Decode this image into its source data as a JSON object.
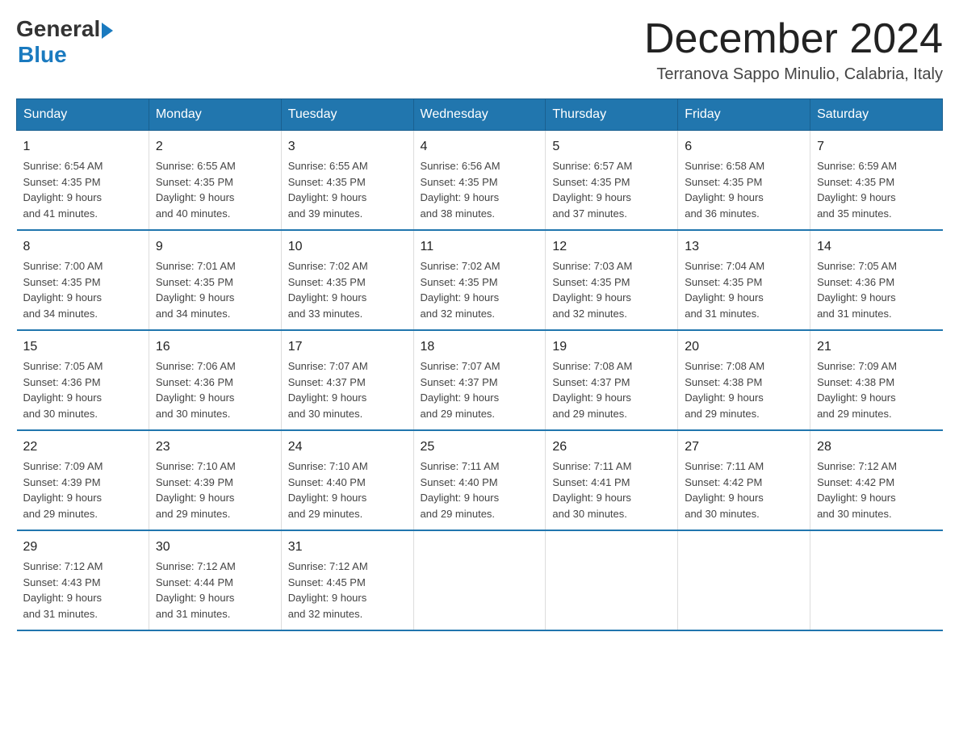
{
  "logo": {
    "general": "General",
    "blue": "Blue"
  },
  "title": {
    "month_year": "December 2024",
    "location": "Terranova Sappo Minulio, Calabria, Italy"
  },
  "header_days": [
    "Sunday",
    "Monday",
    "Tuesday",
    "Wednesday",
    "Thursday",
    "Friday",
    "Saturday"
  ],
  "weeks": [
    [
      {
        "day": "1",
        "sunrise": "6:54 AM",
        "sunset": "4:35 PM",
        "daylight": "9 hours and 41 minutes."
      },
      {
        "day": "2",
        "sunrise": "6:55 AM",
        "sunset": "4:35 PM",
        "daylight": "9 hours and 40 minutes."
      },
      {
        "day": "3",
        "sunrise": "6:55 AM",
        "sunset": "4:35 PM",
        "daylight": "9 hours and 39 minutes."
      },
      {
        "day": "4",
        "sunrise": "6:56 AM",
        "sunset": "4:35 PM",
        "daylight": "9 hours and 38 minutes."
      },
      {
        "day": "5",
        "sunrise": "6:57 AM",
        "sunset": "4:35 PM",
        "daylight": "9 hours and 37 minutes."
      },
      {
        "day": "6",
        "sunrise": "6:58 AM",
        "sunset": "4:35 PM",
        "daylight": "9 hours and 36 minutes."
      },
      {
        "day": "7",
        "sunrise": "6:59 AM",
        "sunset": "4:35 PM",
        "daylight": "9 hours and 35 minutes."
      }
    ],
    [
      {
        "day": "8",
        "sunrise": "7:00 AM",
        "sunset": "4:35 PM",
        "daylight": "9 hours and 34 minutes."
      },
      {
        "day": "9",
        "sunrise": "7:01 AM",
        "sunset": "4:35 PM",
        "daylight": "9 hours and 34 minutes."
      },
      {
        "day": "10",
        "sunrise": "7:02 AM",
        "sunset": "4:35 PM",
        "daylight": "9 hours and 33 minutes."
      },
      {
        "day": "11",
        "sunrise": "7:02 AM",
        "sunset": "4:35 PM",
        "daylight": "9 hours and 32 minutes."
      },
      {
        "day": "12",
        "sunrise": "7:03 AM",
        "sunset": "4:35 PM",
        "daylight": "9 hours and 32 minutes."
      },
      {
        "day": "13",
        "sunrise": "7:04 AM",
        "sunset": "4:35 PM",
        "daylight": "9 hours and 31 minutes."
      },
      {
        "day": "14",
        "sunrise": "7:05 AM",
        "sunset": "4:36 PM",
        "daylight": "9 hours and 31 minutes."
      }
    ],
    [
      {
        "day": "15",
        "sunrise": "7:05 AM",
        "sunset": "4:36 PM",
        "daylight": "9 hours and 30 minutes."
      },
      {
        "day": "16",
        "sunrise": "7:06 AM",
        "sunset": "4:36 PM",
        "daylight": "9 hours and 30 minutes."
      },
      {
        "day": "17",
        "sunrise": "7:07 AM",
        "sunset": "4:37 PM",
        "daylight": "9 hours and 30 minutes."
      },
      {
        "day": "18",
        "sunrise": "7:07 AM",
        "sunset": "4:37 PM",
        "daylight": "9 hours and 29 minutes."
      },
      {
        "day": "19",
        "sunrise": "7:08 AM",
        "sunset": "4:37 PM",
        "daylight": "9 hours and 29 minutes."
      },
      {
        "day": "20",
        "sunrise": "7:08 AM",
        "sunset": "4:38 PM",
        "daylight": "9 hours and 29 minutes."
      },
      {
        "day": "21",
        "sunrise": "7:09 AM",
        "sunset": "4:38 PM",
        "daylight": "9 hours and 29 minutes."
      }
    ],
    [
      {
        "day": "22",
        "sunrise": "7:09 AM",
        "sunset": "4:39 PM",
        "daylight": "9 hours and 29 minutes."
      },
      {
        "day": "23",
        "sunrise": "7:10 AM",
        "sunset": "4:39 PM",
        "daylight": "9 hours and 29 minutes."
      },
      {
        "day": "24",
        "sunrise": "7:10 AM",
        "sunset": "4:40 PM",
        "daylight": "9 hours and 29 minutes."
      },
      {
        "day": "25",
        "sunrise": "7:11 AM",
        "sunset": "4:40 PM",
        "daylight": "9 hours and 29 minutes."
      },
      {
        "day": "26",
        "sunrise": "7:11 AM",
        "sunset": "4:41 PM",
        "daylight": "9 hours and 30 minutes."
      },
      {
        "day": "27",
        "sunrise": "7:11 AM",
        "sunset": "4:42 PM",
        "daylight": "9 hours and 30 minutes."
      },
      {
        "day": "28",
        "sunrise": "7:12 AM",
        "sunset": "4:42 PM",
        "daylight": "9 hours and 30 minutes."
      }
    ],
    [
      {
        "day": "29",
        "sunrise": "7:12 AM",
        "sunset": "4:43 PM",
        "daylight": "9 hours and 31 minutes."
      },
      {
        "day": "30",
        "sunrise": "7:12 AM",
        "sunset": "4:44 PM",
        "daylight": "9 hours and 31 minutes."
      },
      {
        "day": "31",
        "sunrise": "7:12 AM",
        "sunset": "4:45 PM",
        "daylight": "9 hours and 32 minutes."
      },
      null,
      null,
      null,
      null
    ]
  ],
  "labels": {
    "sunrise": "Sunrise:",
    "sunset": "Sunset:",
    "daylight": "Daylight:"
  }
}
